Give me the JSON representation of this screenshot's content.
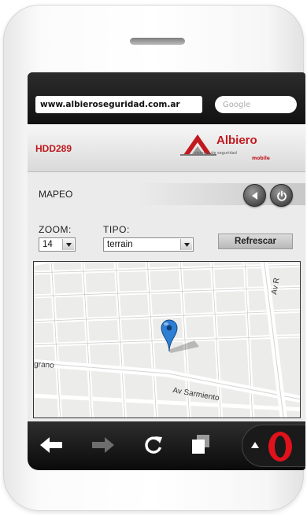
{
  "browser": {
    "url": "www.albieroseguridad.com.ar",
    "search_placeholder": "Google"
  },
  "header": {
    "device_id": "HDD289",
    "logo_name": "Albiero",
    "logo_tagline": "sistema de seguridad",
    "logo_sub": "mobile"
  },
  "section": {
    "label": "MAPEO"
  },
  "controls": {
    "zoom_label": "ZOOM:",
    "zoom_value": "14",
    "tipo_label": "TIPO:",
    "tipo_value": "terrain",
    "refresh_label": "Refrescar"
  },
  "map": {
    "streets": [
      "Av R",
      "grano",
      "Av Sarmiento"
    ]
  },
  "toolbar": {
    "icons": [
      "back-arrow-icon",
      "forward-arrow-icon",
      "reload-icon",
      "tabs-icon",
      "opera-menu-icon"
    ]
  },
  "colors": {
    "brand_red": "#c0191e",
    "marker_blue": "#2d7fd4"
  }
}
